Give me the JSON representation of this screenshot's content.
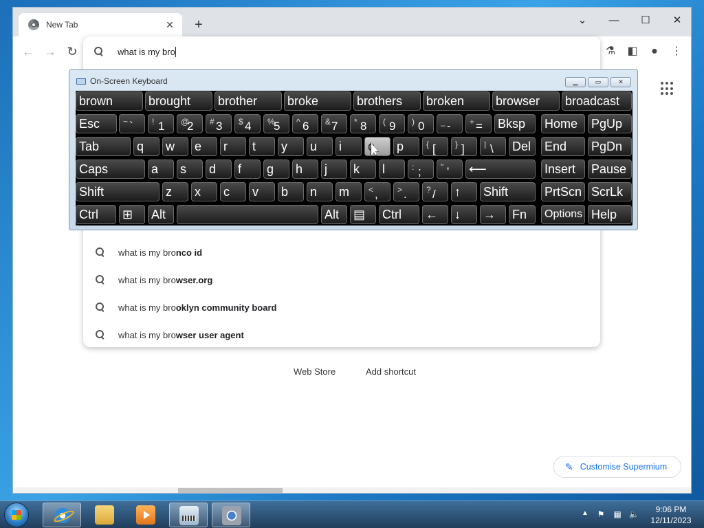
{
  "browser": {
    "tab_title": "New Tab",
    "omnibox_text": "what is my bro",
    "suggestions": [
      {
        "prefix": "what is my bro",
        "bold": "nco id"
      },
      {
        "prefix": "what is my bro",
        "bold": "wser.org"
      },
      {
        "prefix": "what is my bro",
        "bold": "oklyn community board"
      },
      {
        "prefix": "what is my bro",
        "bold": "wser user agent"
      }
    ],
    "shortcuts": [
      "Web Store",
      "Add shortcut"
    ],
    "customise_label": "Customise Supermium"
  },
  "osk": {
    "title": "On-Screen Keyboard",
    "predictions": [
      "brown",
      "brought",
      "brother",
      "broke",
      "brothers",
      "broken",
      "browser",
      "broadcast"
    ],
    "keys": {
      "esc": "Esc",
      "bksp": "Bksp",
      "home": "Home",
      "pgup": "PgUp",
      "tab": "Tab",
      "del": "Del",
      "end": "End",
      "pgdn": "PgDn",
      "caps": "Caps",
      "insert": "Insert",
      "pause": "Pause",
      "shift": "Shift",
      "prtscn": "PrtScn",
      "scrlk": "ScrLk",
      "ctrl": "Ctrl",
      "alt": "Alt",
      "fn": "Fn",
      "options": "Options",
      "help": "Help"
    }
  },
  "taskbar": {
    "time": "9:06 PM",
    "date": "12/11/2023"
  }
}
